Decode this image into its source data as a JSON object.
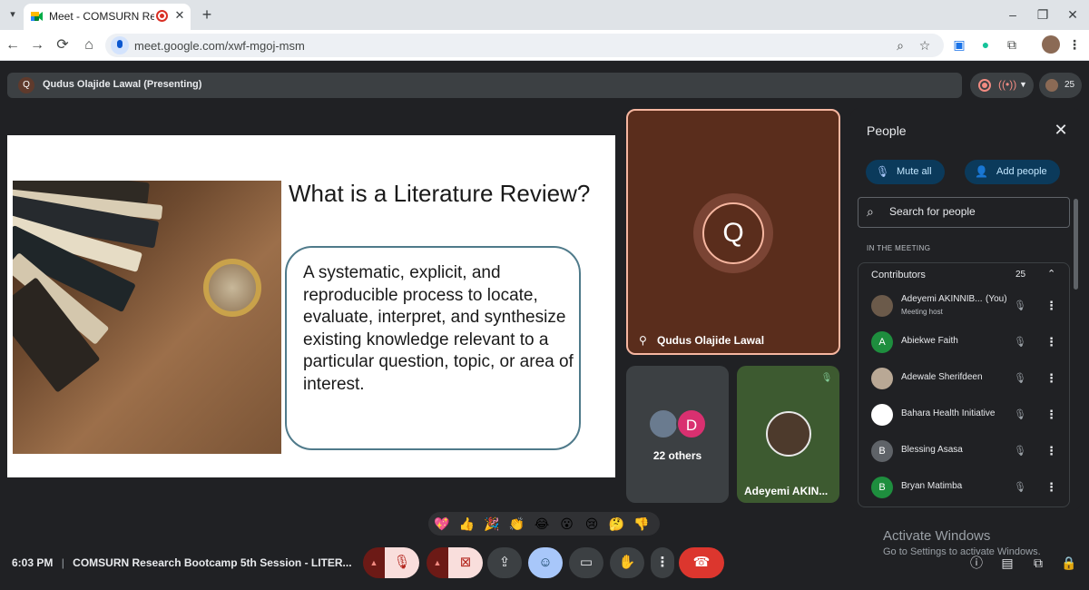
{
  "browser": {
    "tab_title": "Meet - COMSURN Research",
    "url": "meet.google.com/xwf-mgoj-msm",
    "new_tab_symbol": "+",
    "tab_close_symbol": "✕"
  },
  "meet": {
    "presenter_initial": "Q",
    "presenter_bar_text": "Qudus Olajide Lawal (Presenting)",
    "participant_count": "25"
  },
  "slide": {
    "title": "What is a Literature Review?",
    "body": "A systematic, explicit, and reproducible process to locate, evaluate, interpret, and synthesize existing knowledge relevant to a particular question, topic, or area of interest."
  },
  "tiles": {
    "main": {
      "initial": "Q",
      "name": "Qudus Olajide Lawal"
    },
    "others": {
      "initial": "D",
      "label": "22 others"
    },
    "person": {
      "name": "Adeyemi AKIN..."
    }
  },
  "people_panel": {
    "title": "People",
    "mute_all": "Mute all",
    "add_people": "Add people",
    "search_placeholder": "Search for people",
    "section_label": "IN THE MEETING",
    "contributors_label": "Contributors",
    "contributors_count": "25",
    "participants": [
      {
        "name": "Adeyemi AKINNIB...",
        "suffix": "(You)",
        "subtitle": "Meeting host",
        "initial": "",
        "color": "#6b5a4a"
      },
      {
        "name": "Abiekwe Faith",
        "suffix": "",
        "subtitle": "",
        "initial": "A",
        "color": "#1e8e3e"
      },
      {
        "name": "Adewale Sherifdeen",
        "suffix": "",
        "subtitle": "",
        "initial": "",
        "color": "#b9a895"
      },
      {
        "name": "Bahara Health Initiative",
        "suffix": "",
        "subtitle": "",
        "initial": "",
        "color": "#ffffff"
      },
      {
        "name": "Blessing Asasa",
        "suffix": "",
        "subtitle": "",
        "initial": "B",
        "color": "#5f6368"
      },
      {
        "name": "Bryan Matimba",
        "suffix": "",
        "subtitle": "",
        "initial": "B",
        "color": "#1e8e3e"
      }
    ]
  },
  "reactions": [
    "💖",
    "👍",
    "🎉",
    "👏",
    "😂",
    "😮",
    "😢",
    "🤔",
    "👎"
  ],
  "bottom_bar": {
    "time": "6:03 PM",
    "separator": "|",
    "meeting_title": "COMSURN Research Bootcamp 5th Session - LITER..."
  },
  "watermark": {
    "line1": "Activate Windows",
    "line2": "Go to Settings to activate Windows."
  },
  "colors": {
    "end_call": "#dc362e",
    "muted_control": "#f9dedc",
    "active_control": "#a8c7fa",
    "presenter_border": "#f6b6a0"
  }
}
